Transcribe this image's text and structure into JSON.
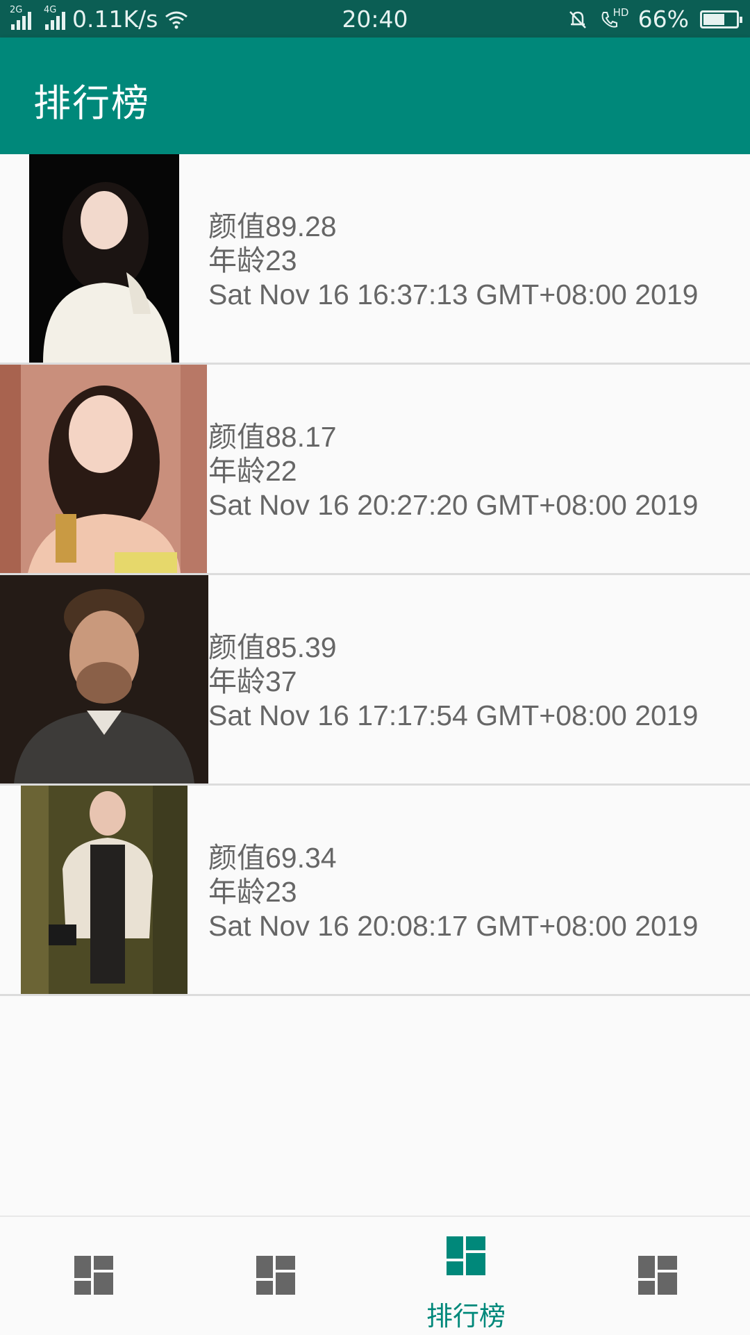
{
  "status": {
    "left_text": "0.11K/s",
    "net1": "2G",
    "net2": "4G",
    "time": "20:40",
    "hd": "HD",
    "battery": "66%",
    "battery_level": 0.66
  },
  "appbar": {
    "title": "排行榜"
  },
  "rows": [
    {
      "score": "颜值89.28",
      "age": "年龄23",
      "date": "Sat Nov 16 16:37:13 GMT+08:00 2019"
    },
    {
      "score": "颜值88.17",
      "age": "年龄22",
      "date": "Sat Nov 16 20:27:20 GMT+08:00 2019"
    },
    {
      "score": "颜值85.39",
      "age": "年龄37",
      "date": "Sat Nov 16 17:17:54 GMT+08:00 2019"
    },
    {
      "score": "颜值69.34",
      "age": "年龄23",
      "date": "Sat Nov 16 20:08:17 GMT+08:00 2019"
    }
  ],
  "nav": {
    "active_label": "排行榜",
    "active_color": "#00887a",
    "inactive_color": "#666666",
    "icons": [
      "dashboard-icon",
      "dashboard-icon",
      "dashboard-icon",
      "dashboard-icon"
    ]
  },
  "colors": {
    "primary": "#00887a",
    "primary_dark": "#0b5e54"
  }
}
